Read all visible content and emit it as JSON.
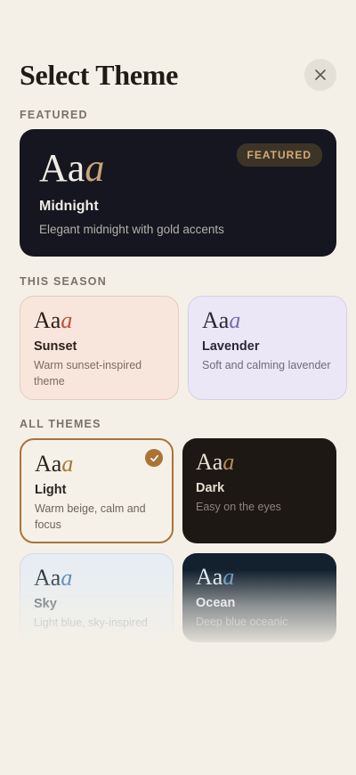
{
  "header": {
    "title": "Select Theme"
  },
  "sections": {
    "featured": "FEATURED",
    "season": "THIS SEASON",
    "all": "ALL THEMES"
  },
  "featured_theme": {
    "sample": "Aa",
    "sample_italic": "a",
    "badge": "FEATURED",
    "name": "Midnight",
    "description": "Elegant midnight with gold accents",
    "colors": {
      "background": "#151620",
      "accent": "#c8a574"
    }
  },
  "season_themes": [
    {
      "sample": "Aa",
      "sample_italic": "a",
      "name": "Sunset",
      "description": "Warm sunset-inspired theme",
      "colors": {
        "background": "#f8e6dc",
        "accent": "#c14f3b"
      }
    },
    {
      "sample": "Aa",
      "sample_italic": "a",
      "name": "Lavender",
      "description": "Soft and calming lavender",
      "colors": {
        "background": "#ebe7f6",
        "accent": "#7d6bb3"
      }
    }
  ],
  "all_themes": [
    {
      "sample": "Aa",
      "sample_italic": "a",
      "name": "Light",
      "description": "Warm beige, calm and focus",
      "selected": true,
      "colors": {
        "background": "#f6f1e8",
        "accent": "#a97436"
      }
    },
    {
      "sample": "Aa",
      "sample_italic": "a",
      "name": "Dark",
      "description": "Easy on the eyes",
      "selected": false,
      "colors": {
        "background": "#1d1814",
        "accent": "#b98d54"
      }
    },
    {
      "sample": "Aa",
      "sample_italic": "a",
      "name": "Sky",
      "description": "Light blue, sky-inspired",
      "selected": false,
      "colors": {
        "background": "#e7edf3",
        "accent": "#4a7fae"
      }
    },
    {
      "sample": "Aa",
      "sample_italic": "a",
      "name": "Ocean",
      "description": "Deep blue oceanic",
      "selected": false,
      "colors": {
        "background": "#13212f",
        "accent": "#5b96c4"
      }
    }
  ],
  "icons": {
    "close": "close-icon",
    "check": "check-icon"
  }
}
